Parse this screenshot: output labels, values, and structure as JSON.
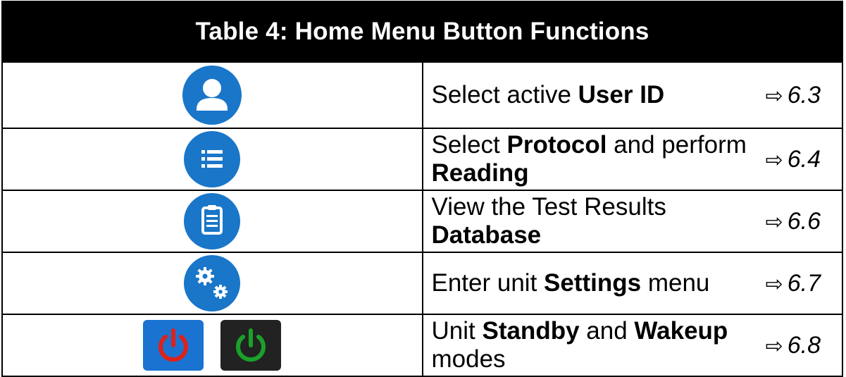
{
  "table": {
    "title": "Table 4: Home Menu Button Functions",
    "rows": [
      {
        "icon": "user-icon",
        "pre": "Select active ",
        "b1": "User ID",
        "mid": "",
        "b2": "",
        "post": "",
        "ref": "6.3"
      },
      {
        "icon": "list-icon",
        "pre": "Select ",
        "b1": "Protocol",
        "mid": " and perform ",
        "b2": "Reading",
        "post": "",
        "ref": "6.4"
      },
      {
        "icon": "clipboard-icon",
        "pre": "View the Test Results ",
        "b1": "Database",
        "mid": "",
        "b2": "",
        "post": "",
        "ref": "6.6"
      },
      {
        "icon": "settings-gears-icon",
        "pre": "Enter unit ",
        "b1": "Settings",
        "mid": " menu",
        "b2": "",
        "post": "",
        "ref": "6.7"
      },
      {
        "icon": "power-icon",
        "pre": "Unit ",
        "b1": "Standby",
        "mid": " and ",
        "b2": "Wakeup",
        "post": " modes",
        "ref": "6.8"
      }
    ],
    "arrow_glyph": "⇨"
  },
  "colors": {
    "icon_blue": "#1976c8",
    "power_red": "#e0201a",
    "power_green": "#1aa12a",
    "header_bg": "#000000"
  }
}
